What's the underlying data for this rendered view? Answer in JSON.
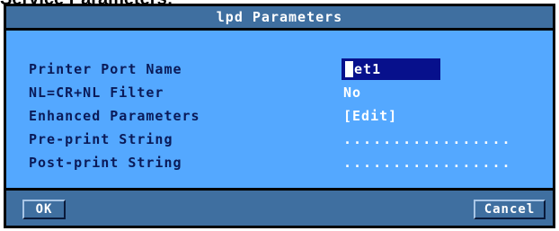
{
  "caption": "Service Parameters:",
  "dialog": {
    "title": "lpd Parameters"
  },
  "fields": {
    "printer_port_name": {
      "label": "Printer Port Name",
      "value": "net1"
    },
    "nl_filter": {
      "label": "NL=CR+NL Filter",
      "value": "No"
    },
    "enhanced": {
      "label": "Enhanced Parameters",
      "value": "[Edit]"
    },
    "pre_print": {
      "label": "Pre-print String",
      "value": "................."
    },
    "post_print": {
      "label": "Post-print String",
      "value": "................."
    }
  },
  "buttons": {
    "ok": "OK",
    "cancel": "Cancel"
  },
  "colors": {
    "panel": "#54a8ff",
    "title_bar": "#3f6fa0",
    "label_text": "#0a1a58",
    "input_bg": "#07108c"
  }
}
